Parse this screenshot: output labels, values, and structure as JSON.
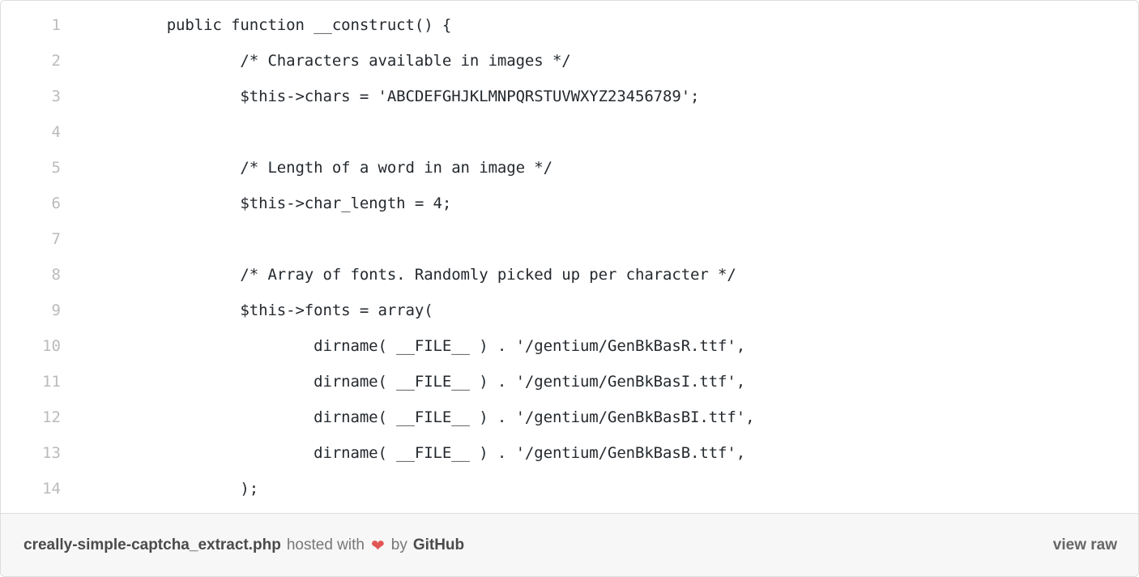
{
  "gist": {
    "filename": "creally-simple-captcha_extract.php",
    "hosted_with_label": "hosted with",
    "heart_icon": "heart-icon",
    "heart_glyph": "❤",
    "by_label": "by",
    "host_name": "GitHub",
    "view_raw_label": "view raw",
    "accent_color": "#e25555",
    "border_color": "#dddddd",
    "footer_bg": "#f7f7f7",
    "code_color": "#24292e",
    "line_number_color": "#babbbd"
  },
  "code": {
    "language": "php",
    "lines": [
      {
        "n": "1",
        "text": "        public function __construct() {"
      },
      {
        "n": "2",
        "text": "                /* Characters available in images */"
      },
      {
        "n": "3",
        "text": "                $this->chars = 'ABCDEFGHJKLMNPQRSTUVWXYZ23456789';"
      },
      {
        "n": "4",
        "text": ""
      },
      {
        "n": "5",
        "text": "                /* Length of a word in an image */"
      },
      {
        "n": "6",
        "text": "                $this->char_length = 4;"
      },
      {
        "n": "7",
        "text": ""
      },
      {
        "n": "8",
        "text": "                /* Array of fonts. Randomly picked up per character */"
      },
      {
        "n": "9",
        "text": "                $this->fonts = array("
      },
      {
        "n": "10",
        "text": "                        dirname( __FILE__ ) . '/gentium/GenBkBasR.ttf',"
      },
      {
        "n": "11",
        "text": "                        dirname( __FILE__ ) . '/gentium/GenBkBasI.ttf',"
      },
      {
        "n": "12",
        "text": "                        dirname( __FILE__ ) . '/gentium/GenBkBasBI.ttf',"
      },
      {
        "n": "13",
        "text": "                        dirname( __FILE__ ) . '/gentium/GenBkBasB.ttf',"
      },
      {
        "n": "14",
        "text": "                );"
      }
    ]
  }
}
